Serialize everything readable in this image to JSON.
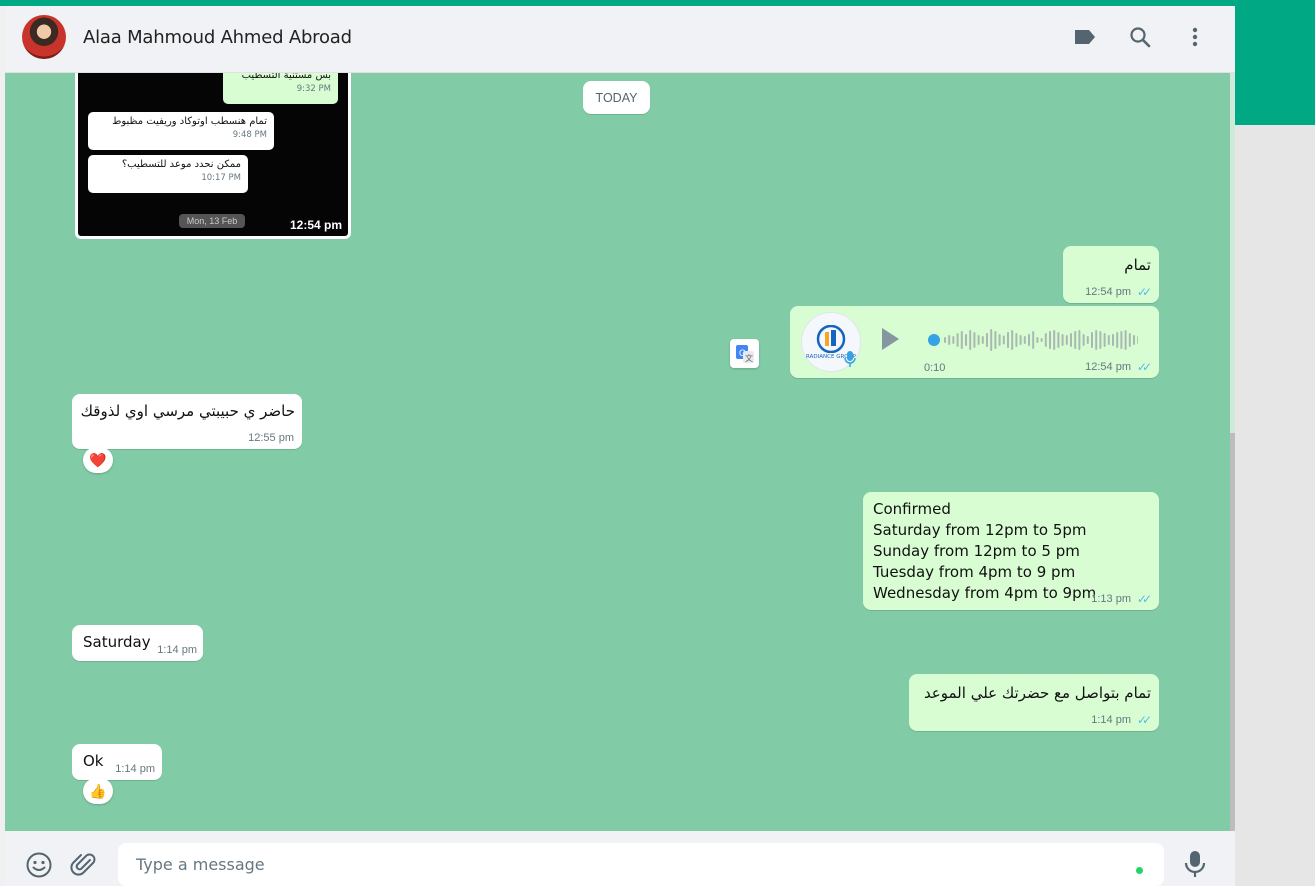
{
  "header": {
    "contact_name": "Alaa Mahmoud Ahmed Abroad",
    "icons": [
      "label-icon",
      "search-icon",
      "kebab-menu-icon"
    ]
  },
  "chat": {
    "date_divider": "TODAY",
    "screenshot_message": {
      "inner": {
        "top_text": "بس مستنية التسطيب",
        "top_time": "9:32 PM",
        "msg1_text": "تمام هنسطب اوتوكاد وريفيت مظبوط",
        "msg1_time": "9:48 PM",
        "msg2_text": "ممكن نحدد موعد للتسطيب؟",
        "msg2_time": "10:17 PM",
        "date_label": "Mon, 13 Feb"
      },
      "time": "12:54 pm"
    },
    "messages": [
      {
        "id": "m1",
        "direction": "out",
        "text": "تمام",
        "time": "12:54 pm"
      },
      {
        "id": "m2",
        "direction": "out",
        "type": "voice",
        "duration": "0:10",
        "time": "12:54 pm",
        "avatar_label": "RADIANCE GROUP"
      },
      {
        "id": "m3",
        "direction": "in",
        "text": "حاضر ي حبيبتي مرسي اوي لذوقك",
        "time": "12:55 pm",
        "reaction": "❤️"
      },
      {
        "id": "m4",
        "direction": "out",
        "lines": [
          "Confirmed",
          "Saturday from 12pm to 5pm",
          "Sunday from 12pm to 5 pm",
          "Tuesday from 4pm to 9 pm",
          "Wednesday from 4pm to 9pm"
        ],
        "time": "1:13 pm"
      },
      {
        "id": "m5",
        "direction": "in",
        "text": "Saturday",
        "time": "1:14 pm"
      },
      {
        "id": "m6",
        "direction": "out",
        "text": "تمام بتواصل مع حضرتك علي الموعد",
        "time": "1:14 pm"
      },
      {
        "id": "m7",
        "direction": "in",
        "text": "Ok",
        "time": "1:14 pm",
        "reaction": "👍"
      }
    ]
  },
  "footer": {
    "placeholder": "Type a message",
    "icons": [
      "emoji-icon",
      "attach-icon",
      "microphone-icon"
    ]
  },
  "colors": {
    "accent": "#00a884",
    "chat_bg": "#81cca7",
    "outgoing_bubble": "#d9fdd3",
    "incoming_bubble": "#ffffff",
    "read_ticks": "#53bdeb"
  }
}
